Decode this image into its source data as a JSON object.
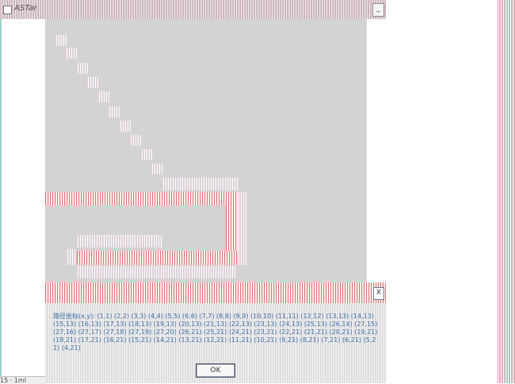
{
  "window": {
    "title": "ASTar",
    "minimize_label": "_"
  },
  "status": {
    "text": "15  ·  1ml"
  },
  "dialog": {
    "close_label": "X",
    "message": "路径坐标(x,y): (1,1) (2,2) (3,3) (4,4) (5,5) (6,6) (7,7) (8,8) (9,9) (10,10) (11,11) (12,12) (13,13) (14,13) (15,13) (16,13) (17,13) (18,13) (19,13) (20,13) (21,13) (22,13) (23,13) (24,13) (25,13) (26,14) (27,15) (27,16) (27,17) (27,18) (27,19) (27,20) (26,21) (25,21) (24,21) (23,21) (22,21) (21,21) (20,21) (19,21) (18,21) (17,21) (16,21) (15,21) (14,21) (13,21) (12,21) (11,21) (10,21) (9,21) (8,21) (7,21) (6,21) (5,21) (4,21)",
    "ok_label": "OK"
  },
  "colors": {
    "canvas_bg": "#d3d3d3",
    "path_red": "#e07070",
    "dialog_text": "#3a6ea8"
  }
}
